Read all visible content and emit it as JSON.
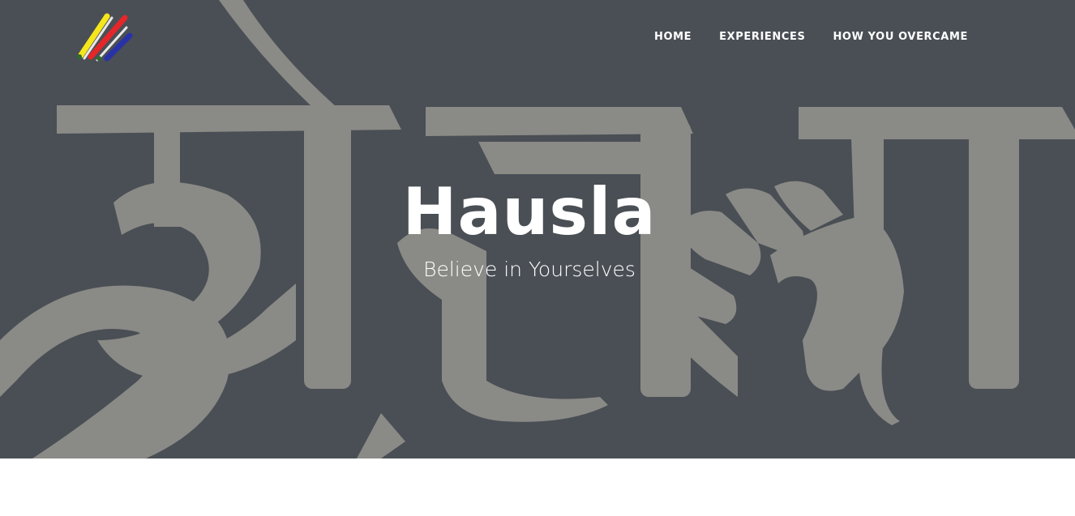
{
  "brand": {
    "logo_icon": "paint-stripes-logo",
    "stripe_colors": [
      "#f5e71b",
      "#e52629",
      "#2832a6",
      "#e8e8e8"
    ]
  },
  "nav": {
    "items": [
      {
        "label": "HOME"
      },
      {
        "label": "EXPERIENCES"
      },
      {
        "label": "HOW YOU OVERCAME"
      }
    ]
  },
  "hero": {
    "title": "Hausla",
    "subtitle": "Believe in Yourselves",
    "background_color": "#4a4f55",
    "art_color": "#8a8a86",
    "art_icon": "devanagari-hausla-fist-artwork"
  }
}
